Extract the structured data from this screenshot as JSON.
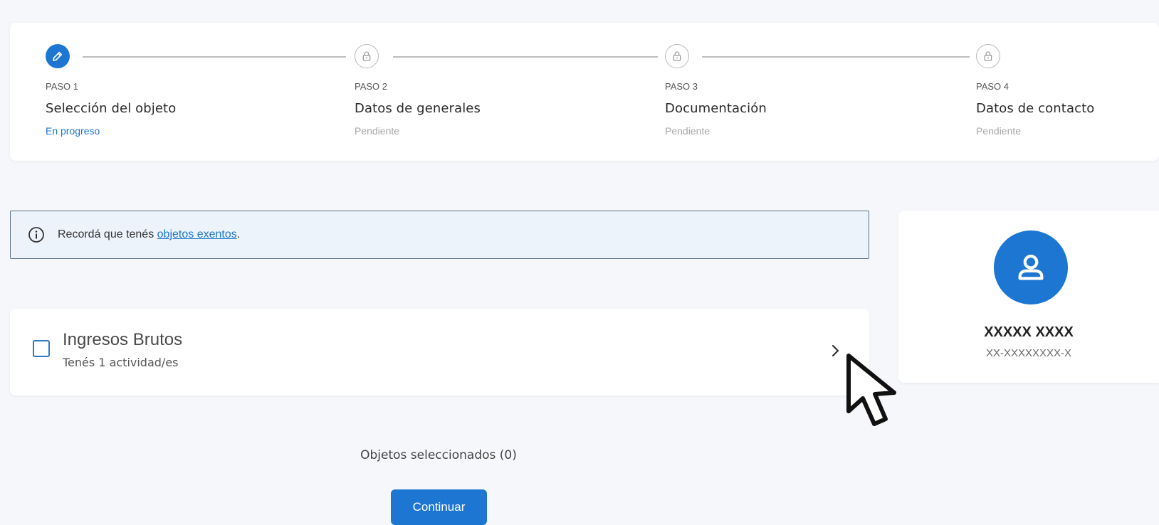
{
  "stepper": {
    "steps": [
      {
        "number": "PASO 1",
        "title": "Selección del objeto",
        "status": "En progreso",
        "icon": "pencil-icon",
        "state": "active"
      },
      {
        "number": "PASO 2",
        "title": "Datos de generales",
        "status": "Pendiente",
        "icon": "lock-icon",
        "state": "pending"
      },
      {
        "number": "PASO 3",
        "title": "Documentación",
        "status": "Pendiente",
        "icon": "lock-icon",
        "state": "pending"
      },
      {
        "number": "PASO 4",
        "title": "Datos de contacto",
        "status": "Pendiente",
        "icon": "lock-icon",
        "state": "pending"
      }
    ]
  },
  "info": {
    "icon": "info-icon",
    "text": "Recordá que tenés ",
    "link": "objetos exentos",
    "suffix": "."
  },
  "object": {
    "title": "Ingresos Brutos",
    "subtitle": "Tenés 1 actividad/es",
    "checked": false
  },
  "profile": {
    "name": "XXXXX XXXX",
    "id": "XX-XXXXXXXX-X",
    "icon": "user-icon"
  },
  "footer": {
    "selected_label": "Objetos seleccionados (0)",
    "continue_label": "Continuar"
  },
  "colors": {
    "accent": "#1d76d2",
    "pending": "#a7a7a7",
    "info_bg": "#edf3fb",
    "info_border": "#5c7189"
  }
}
